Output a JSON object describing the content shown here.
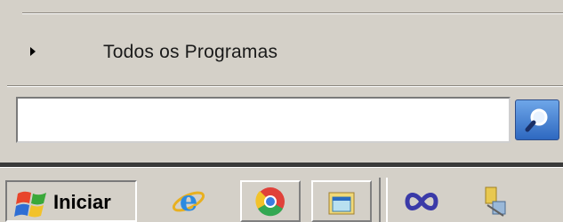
{
  "start_menu": {
    "all_programs_label": "Todos os Programas",
    "search": {
      "value": "",
      "placeholder": ""
    }
  },
  "taskbar": {
    "start_button_label": "Iniciar",
    "quick_launch": [
      {
        "name": "internet-explorer",
        "icon": "ie-icon"
      },
      {
        "name": "chrome",
        "icon": "chrome-icon"
      },
      {
        "name": "file-manager",
        "icon": "folder-window-icon"
      },
      {
        "name": "infinity-app",
        "icon": "infinity-icon"
      },
      {
        "name": "network-tool",
        "icon": "network-icon"
      }
    ]
  }
}
